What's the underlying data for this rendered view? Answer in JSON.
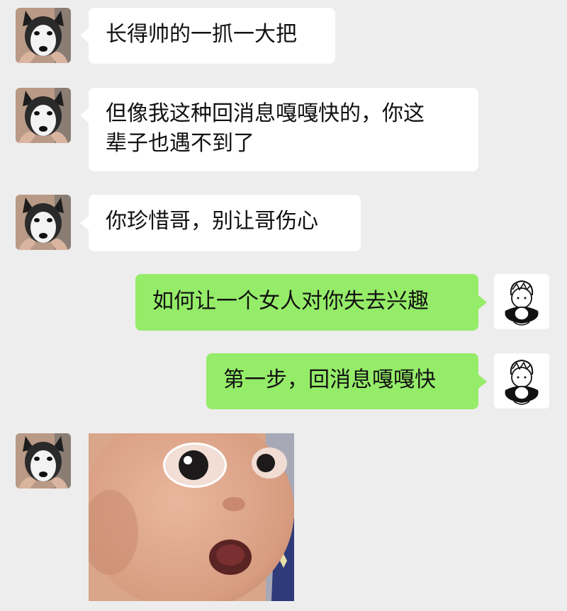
{
  "chat": {
    "messages": [
      {
        "side": "received",
        "lines": [
          "长得帅的一抓一大把"
        ]
      },
      {
        "side": "received",
        "lines": [
          "但像我这种回消息嘎嘎快的，你这",
          "辈子也遇不到了"
        ]
      },
      {
        "side": "received",
        "lines": [
          "你珍惜哥，别让哥伤心"
        ]
      },
      {
        "side": "sent",
        "lines": [
          "如何让一个女人对你失去兴趣"
        ]
      },
      {
        "side": "sent",
        "lines": [
          "第一步，回消息嘎嘎快"
        ]
      },
      {
        "side": "received",
        "type": "sticker",
        "sticker": "surprised-baby-face"
      }
    ]
  },
  "avatars": {
    "received": "husky-dog-avatar",
    "sent": "cartoon-boy-avatar"
  },
  "colors": {
    "background": "#ededed",
    "received_bubble": "#ffffff",
    "sent_bubble": "#95ec69",
    "text": "#111111"
  }
}
